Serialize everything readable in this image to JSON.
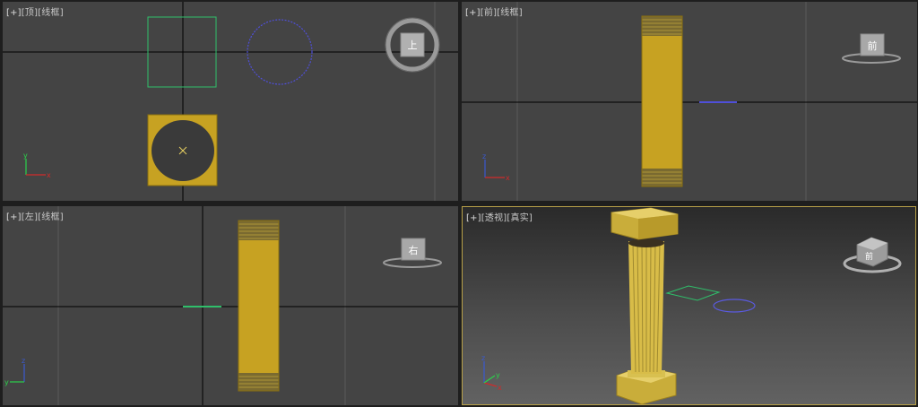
{
  "viewports": {
    "top": {
      "plus": "[+]",
      "name": "[顶]",
      "mode": "[线框]",
      "cube_face": "上"
    },
    "front": {
      "plus": "[+]",
      "name": "[前]",
      "mode": "[线框]",
      "cube_face": "前"
    },
    "left": {
      "plus": "[+]",
      "name": "[左]",
      "mode": "[线框]",
      "cube_face": "右"
    },
    "perspective": {
      "plus": "[+]",
      "name": "[透视]",
      "mode": "[真实]",
      "cube_face": "前"
    }
  },
  "axis_labels": {
    "x": "x",
    "y": "y",
    "z": "z"
  },
  "colors": {
    "viewport_bg": "#444444",
    "grid_axis": "#000000",
    "grid_line": "#5a5a5a",
    "column_gold": "#c7a222",
    "rect_shape": "#2fbf6a",
    "circle_shape": "#4f4fd9",
    "active_border": "#b8a048"
  },
  "icons": [
    "viewcube-icon",
    "axis-tripod-icon"
  ]
}
